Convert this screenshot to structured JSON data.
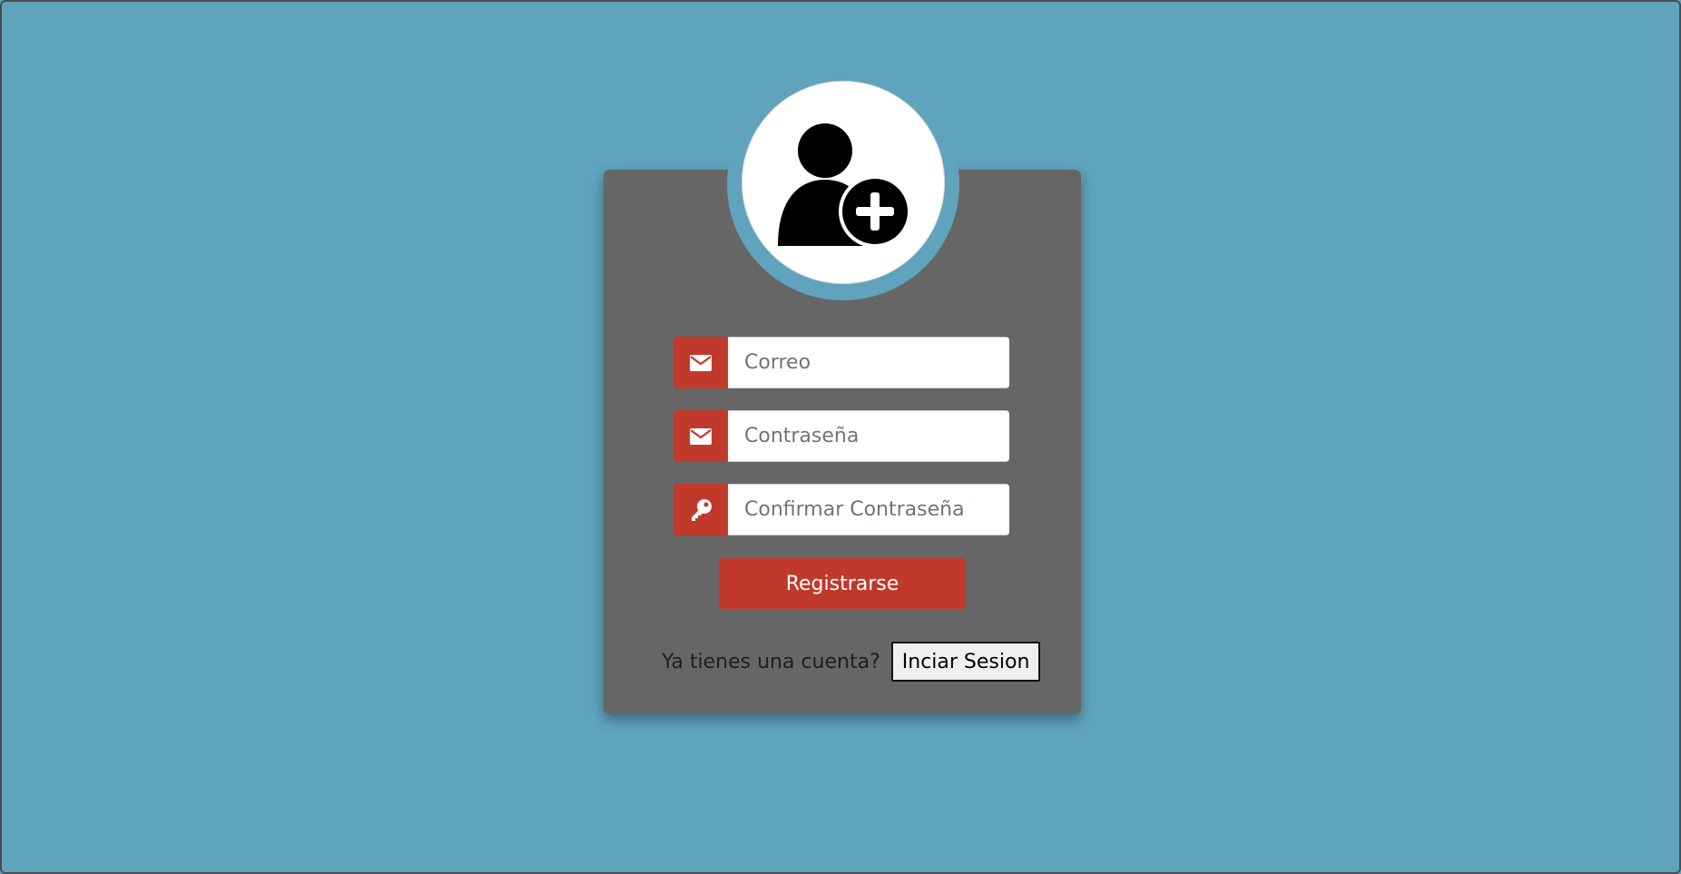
{
  "form": {
    "avatar_icon": "user-plus-icon",
    "fields": [
      {
        "placeholder": "Correo",
        "value": "",
        "icon": "envelope-icon"
      },
      {
        "placeholder": "Contraseña",
        "value": "",
        "icon": "envelope-icon"
      },
      {
        "placeholder": "Confirmar Contraseña",
        "value": "",
        "icon": "key-icon"
      }
    ],
    "register_label": "Registrarse",
    "login_prompt": "Ya tienes una cuenta?",
    "login_label": "Inciar Sesion"
  },
  "colors": {
    "background": "#5fa3bd",
    "card": "#666666",
    "accent": "#c0392b",
    "avatar_bg": "#ffffff"
  }
}
